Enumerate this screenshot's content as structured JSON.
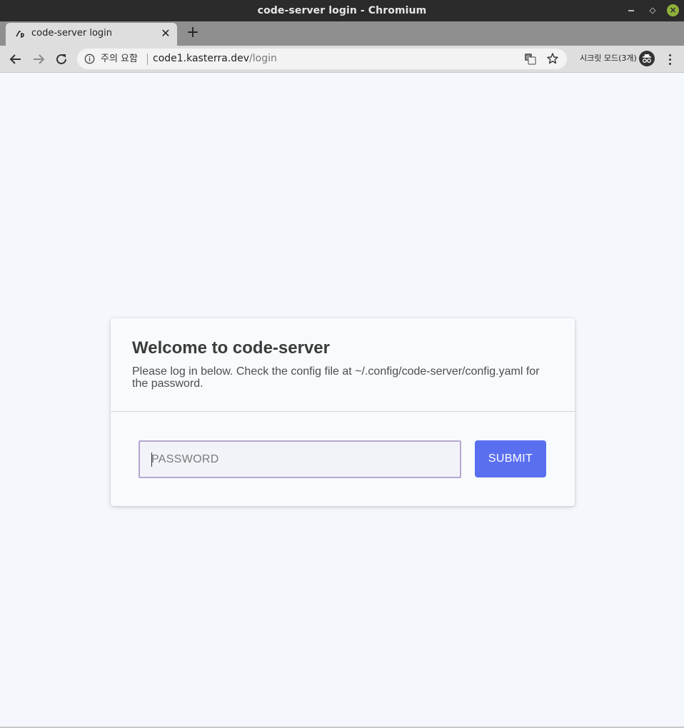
{
  "window": {
    "title": "code-server login - Chromium"
  },
  "tab": {
    "title": "code-server login"
  },
  "address_bar": {
    "security_label": "주의 요함",
    "host": "code1.kasterra.dev",
    "path": "/login"
  },
  "toolbar": {
    "incognito_label": "시크릿 모드(3개)"
  },
  "login": {
    "heading": "Welcome to code-server",
    "description": "Please log in below. Check the config file at ~/.config/code-server/config.yaml for the password.",
    "password_placeholder": "PASSWORD",
    "password_value": "",
    "submit_label": "SUBMIT"
  },
  "colors": {
    "accent": "#5a6ff0",
    "page_background": "#f4f7fb",
    "titlebar": "#2b2b2b",
    "close_button": "#8fb13a"
  },
  "icons": [
    "back-arrow-icon",
    "forward-arrow-icon",
    "reload-icon",
    "info-icon",
    "translate-icon",
    "star-icon",
    "incognito-icon",
    "more-menu-icon",
    "code-server-favicon",
    "tab-close-icon",
    "new-tab-icon"
  ]
}
